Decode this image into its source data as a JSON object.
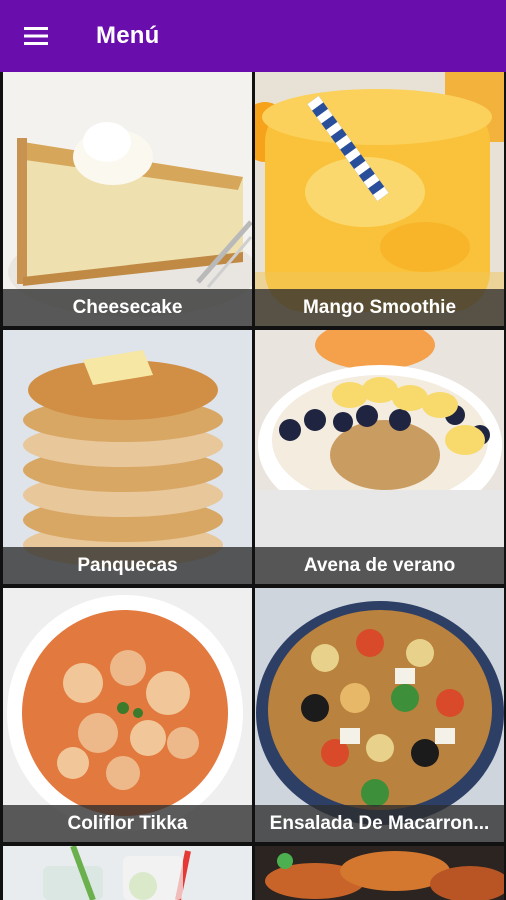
{
  "appbar": {
    "title": "Menú",
    "menu_icon": "hamburger-menu-icon",
    "background": "#6a0dad"
  },
  "recipes": [
    {
      "name": "Cheesecake"
    },
    {
      "name": "Mango Smoothie"
    },
    {
      "name": "Panquecas"
    },
    {
      "name": "Avena de verano"
    },
    {
      "name": "Coliflor Tikka"
    },
    {
      "name": "Ensalada De Macarron..."
    }
  ]
}
